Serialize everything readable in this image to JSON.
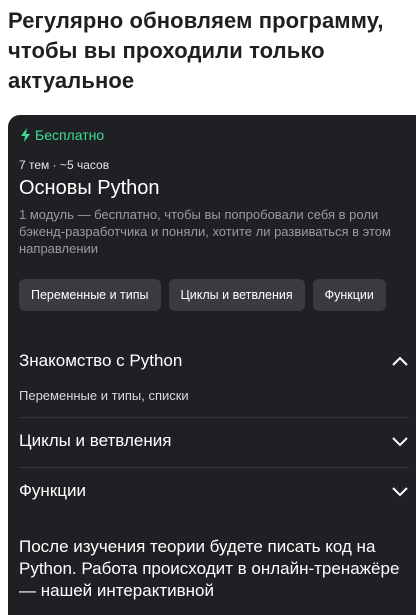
{
  "heading": "Регулярно обновляем программу, чтобы вы проходили только актуальное",
  "card": {
    "badge": "Бесплатно",
    "meta": "7 тем · ~5 часов",
    "title": "Основы Python",
    "description": "1 модуль — бесплатно, чтобы вы попробовали себя в роли бэкенд-разработчика и поняли, хотите ли развиваться в этом направлении",
    "tags": [
      "Переменные и типы",
      "Циклы и ветвления",
      "Функции"
    ],
    "sections": [
      {
        "title": "Знакомство с Python",
        "subtitle": "Переменные и типы, списки",
        "expanded": true
      },
      {
        "title": "Циклы и ветвления",
        "expanded": false
      },
      {
        "title": "Функции",
        "expanded": false
      }
    ],
    "bottom_text": "После изучения теории будете писать код на Python. Работа происходит в онлайн-тренажёре — нашей интерактивной"
  },
  "colors": {
    "badge": "#3ddc97",
    "card_bg": "#1f2024"
  },
  "icons": {
    "badge": "lightning-icon",
    "collapse": "chevron-up-icon",
    "expand": "chevron-down-icon"
  }
}
